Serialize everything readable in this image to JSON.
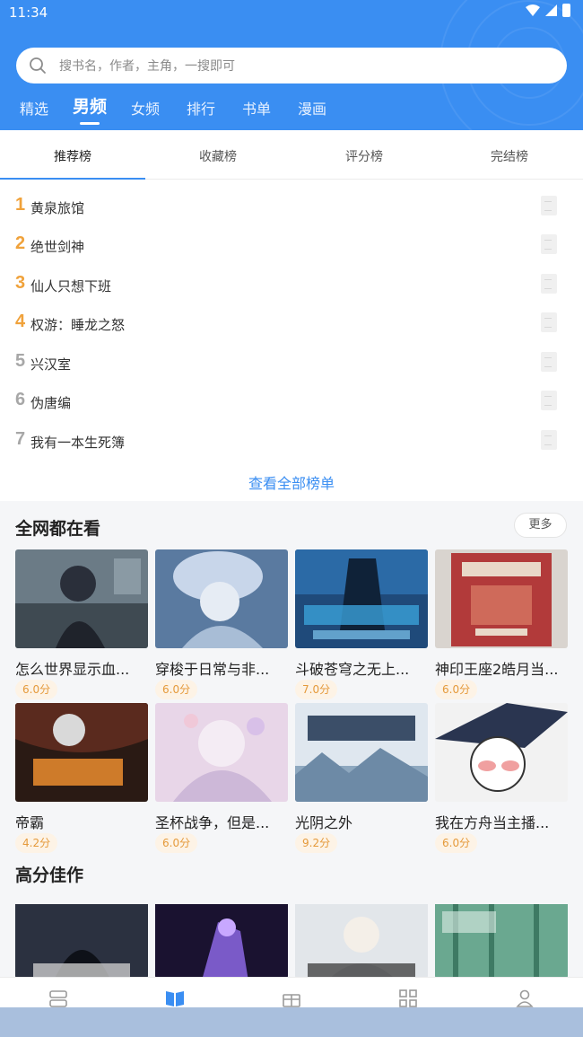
{
  "status": {
    "time": "11:34"
  },
  "search": {
    "placeholder": "搜书名，作者，主角，一搜即可"
  },
  "nav": [
    {
      "label": "精选"
    },
    {
      "label": "男频",
      "active": true
    },
    {
      "label": "女频"
    },
    {
      "label": "排行"
    },
    {
      "label": "书单"
    },
    {
      "label": "漫画"
    }
  ],
  "rank_tabs": [
    {
      "label": "推荐榜",
      "active": true
    },
    {
      "label": "收藏榜"
    },
    {
      "label": "评分榜"
    },
    {
      "label": "完结榜"
    }
  ],
  "rank_list": [
    {
      "num": "1",
      "title": "黄泉旅馆",
      "color": "#f0a23b"
    },
    {
      "num": "2",
      "title": "绝世剑神",
      "color": "#f0a23b"
    },
    {
      "num": "3",
      "title": "仙人只想下班",
      "color": "#f0a23b"
    },
    {
      "num": "4",
      "title": "权游：睡龙之怒",
      "color": "#f0a23b"
    },
    {
      "num": "5",
      "title": "兴汉室",
      "color": "#a7a7a7"
    },
    {
      "num": "6",
      "title": "伪唐编",
      "color": "#a7a7a7"
    },
    {
      "num": "7",
      "title": "我有一本生死簿",
      "color": "#a7a7a7"
    }
  ],
  "view_all": "查看全部榜单",
  "section_popular": {
    "title": "全网都在看",
    "more": "更多"
  },
  "popular_books": [
    {
      "title": "怎么世界显示血...",
      "score": "6.0分"
    },
    {
      "title": "穿梭于日常与非...",
      "score": "6.0分"
    },
    {
      "title": "斗破苍穹之无上...",
      "score": "7.0分"
    },
    {
      "title": "神印王座2皓月当...",
      "score": "6.0分"
    },
    {
      "title": "帝霸",
      "score": "4.2分"
    },
    {
      "title": "圣杯战争，但是...",
      "score": "6.0分"
    },
    {
      "title": "光阴之外",
      "score": "9.2分"
    },
    {
      "title": "我在方舟当主播...",
      "score": "6.0分"
    }
  ],
  "section_high": {
    "title": "高分佳作"
  },
  "colors": {
    "accent": "#3a8ef2",
    "rank_top": "#f0a23b",
    "rank_other": "#a7a7a7",
    "score": "#e59a3b"
  },
  "bottom_nav": [
    {
      "icon": "bookshelf-icon"
    },
    {
      "icon": "book-open-icon",
      "active": true
    },
    {
      "icon": "gift-icon"
    },
    {
      "icon": "grid-icon"
    },
    {
      "icon": "user-icon"
    }
  ]
}
